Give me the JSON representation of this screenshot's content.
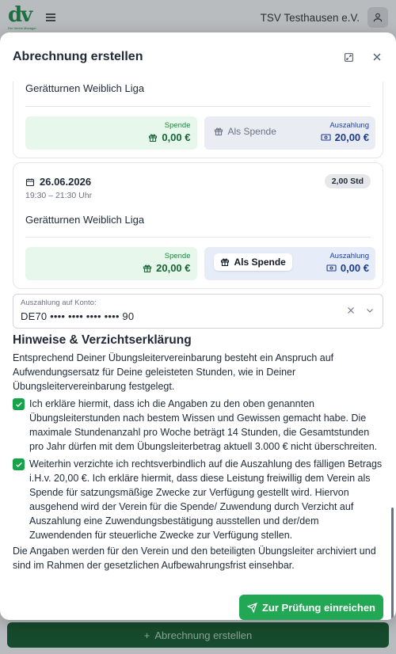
{
  "app": {
    "logo_text": "dv",
    "logo_sub": "Der Verein Manager",
    "club_name": "TSV Testhausen e.V.",
    "bottom_button": "Abrechnung erstellen"
  },
  "modal": {
    "title": "Abrechnung erstellen",
    "entries": [
      {
        "course": "Gerätturnen Weiblich Liga",
        "spende_label": "Spende",
        "spende_value": "0,00 €",
        "als_spende": "Als Spende",
        "auszahlung_label": "Auszahlung",
        "auszahlung_value": "20,00 €"
      },
      {
        "date": "26.06.2026",
        "time": "19:30 – 21:30 Uhr",
        "hours": "2,00 Std",
        "course": "Gerätturnen Weiblich Liga",
        "spende_label": "Spende",
        "spende_value": "20,00 €",
        "als_spende": "Als Spende",
        "auszahlung_label": "Auszahlung",
        "auszahlung_value": "0,00 €"
      }
    ],
    "account": {
      "label": "Auszahlung auf Konto:",
      "value": "DE70 •••• •••• •••• •••• 90"
    },
    "notes": {
      "title": "Hinweise & Verzichtserklärung",
      "intro": "Entsprechend Deiner Übungsleitervereinbarung besteht ein Anspruch auf Aufwendungsersatz für Deine geleisteten Stunden, wie in Deiner Übungsleitervereinbarung festgelegt.",
      "check1": "Ich erkläre hiermit, dass ich die Angaben zu den oben genannten Übungsleiterstunden nach bestem Wissen und Gewissen gemacht habe. Die maximale Stundenanzahl pro Woche beträgt 14 Stunden, die Gesamtstunden pro Jahr dürfen mit dem Übungsleiterbetrag aktuell 3.000 € nicht überschreiten.",
      "check2": "Weiterhin verzichte ich rechtsverbindlich auf die Auszahlung des fälligen Betrags i.H.v. 20,00 €. Ich erkläre hiermit, dass diese Leistung freiwillig dem Verein als Spende für satzungsmäßige Zwecke zur Verfügung gestellt wird. Hiervon ausgehend wird der Verein für die Spende/ Zuwendung durch Verzicht auf Auszahlung eine Zuwendungsbestätigung ausstellen und der/dem Zuwendenden für steuerliche Zwecke zur Verfügung stellen.",
      "outro": "Die Angaben werden für den Verein und den beteiligten Übungsleiter archiviert und sind im Rahmen der gesetzlichen Aufbewahrungsfrist einsehbar."
    },
    "submit": "Zur Prüfung einreichen"
  },
  "colors": {
    "primary_green": "#22a854",
    "spende_bg": "#e8f7ec",
    "auszahlung_bg": "#e6edf8"
  }
}
